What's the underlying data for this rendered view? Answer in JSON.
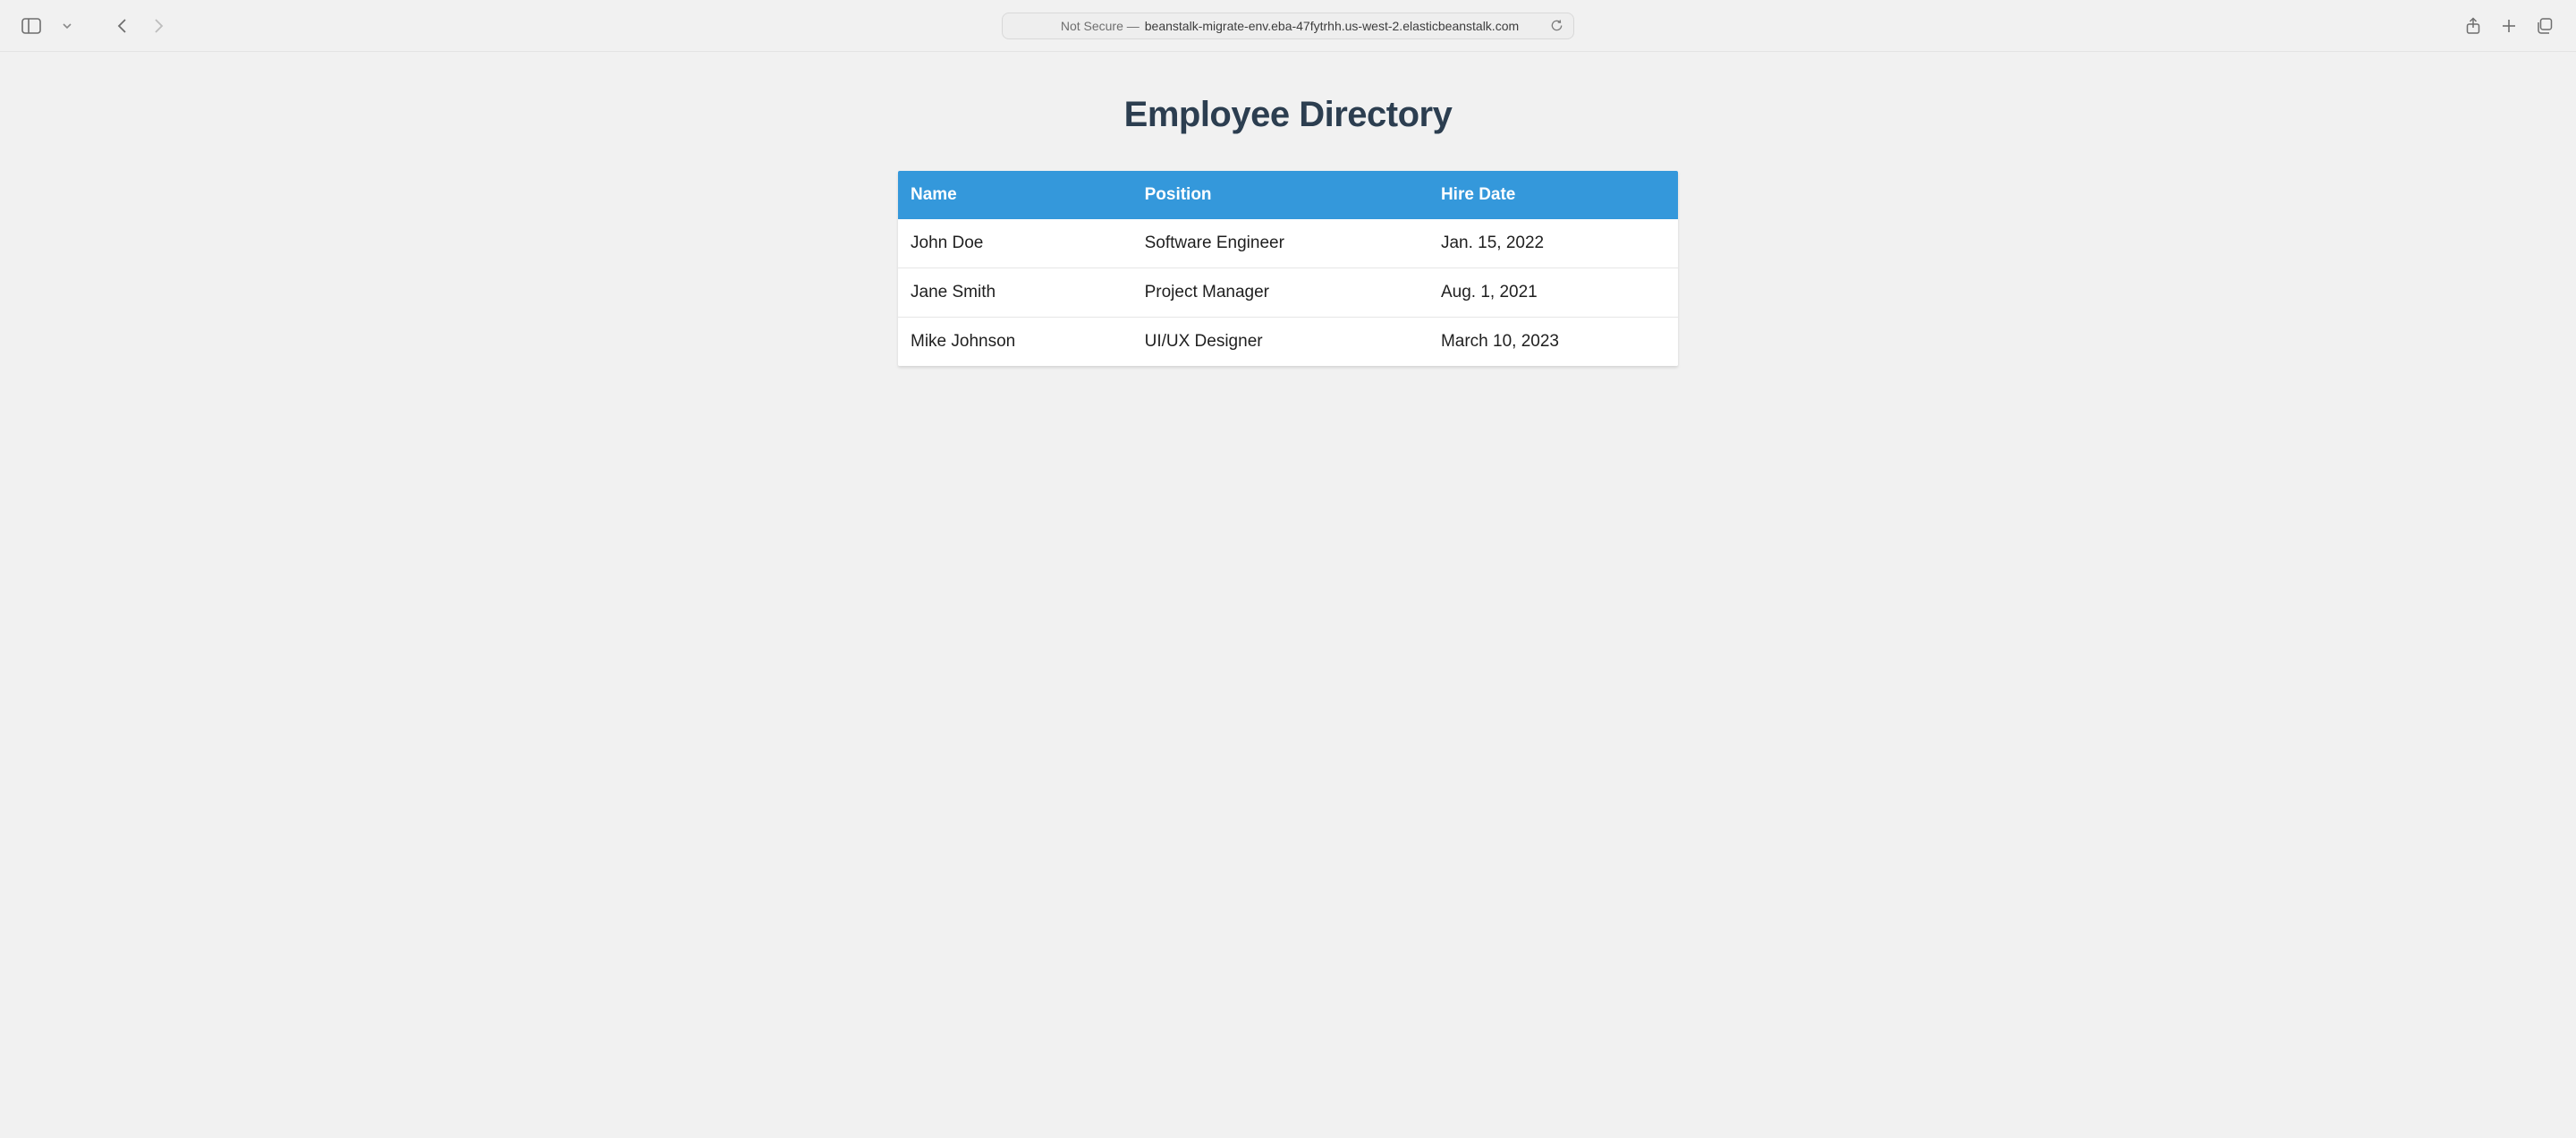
{
  "browser": {
    "address_prefix": "Not Secure —",
    "address_host": "beanstalk-migrate-env.eba-47fytrhh.us-west-2.elasticbeanstalk.com"
  },
  "page": {
    "title": "Employee Directory"
  },
  "table": {
    "columns": [
      "Name",
      "Position",
      "Hire Date"
    ],
    "rows": [
      {
        "name": "John Doe",
        "position": "Software Engineer",
        "hire_date": "Jan. 15, 2022"
      },
      {
        "name": "Jane Smith",
        "position": "Project Manager",
        "hire_date": "Aug. 1, 2021"
      },
      {
        "name": "Mike Johnson",
        "position": "UI/UX Designer",
        "hire_date": "March 10, 2023"
      }
    ]
  },
  "colors": {
    "header_bg": "#3498db",
    "title_color": "#2c3e50",
    "page_bg": "#f1f1f1"
  }
}
